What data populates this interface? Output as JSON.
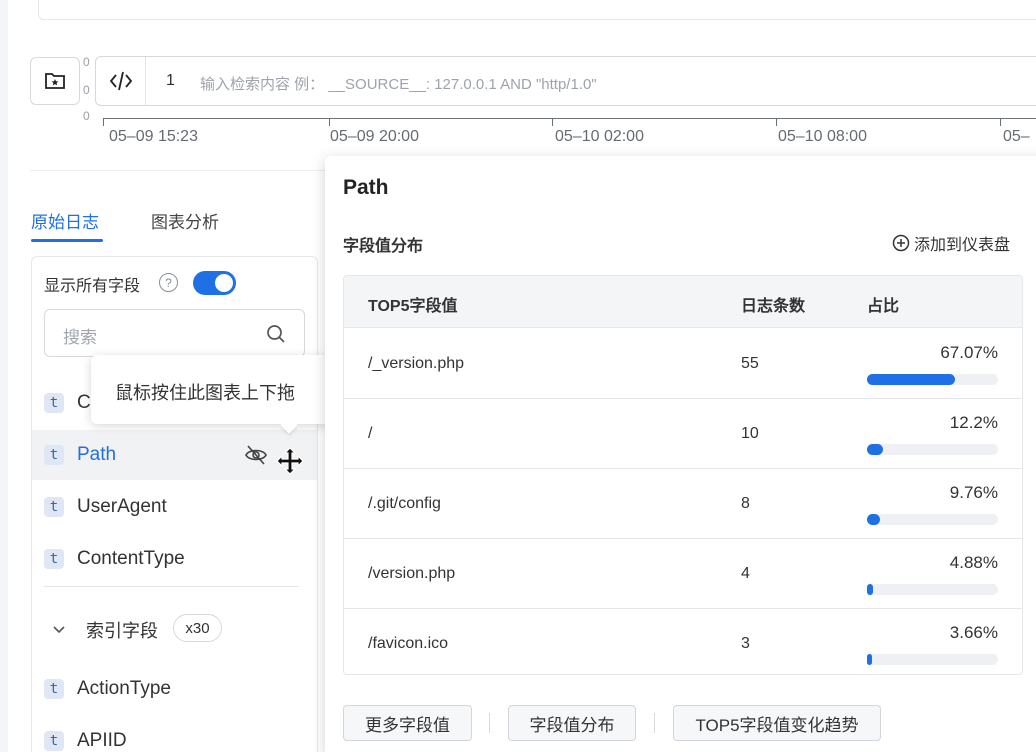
{
  "query_bar": {
    "line_number": "1",
    "placeholder": "输入检索内容 例： __SOURCE__: 127.0.0.1 AND \"http/1.0\"",
    "axis_zero_top": "0",
    "axis_zero_mid": "0",
    "axis_zero_bottom": "0"
  },
  "time_axis": {
    "labels": [
      "05–09 15:23",
      "05–09 20:00",
      "05–10 02:00",
      "05–10 08:00",
      "05–"
    ]
  },
  "tabs": [
    {
      "label": "原始日志",
      "active": true
    },
    {
      "label": "图表分析",
      "active": false
    }
  ],
  "field_panel": {
    "show_all_label": "显示所有字段",
    "help_icon": "?",
    "toggle_on": true,
    "search_placeholder": "搜索",
    "fields": [
      {
        "type": "t",
        "name": "C"
      },
      {
        "type": "t",
        "name": "Path"
      },
      {
        "type": "t",
        "name": "UserAgent"
      },
      {
        "type": "t",
        "name": "ContentType"
      }
    ],
    "index_group": {
      "label": "索引字段",
      "count": "x30"
    },
    "index_fields": [
      {
        "type": "t",
        "name": "ActionType"
      },
      {
        "type": "t",
        "name": "APIID"
      }
    ]
  },
  "tooltip": {
    "text": "鼠标按住此图表上下拖"
  },
  "popover": {
    "title": "Path",
    "subtitle": "字段值分布",
    "add_to_dashboard": "添加到仪表盘",
    "table": {
      "headers": [
        "TOP5字段值",
        "日志条数",
        "占比"
      ],
      "rows": [
        {
          "value": "/_version.php",
          "count": "55",
          "percent": "67.07%",
          "ratio": 0.6707
        },
        {
          "value": "/",
          "count": "10",
          "percent": "12.2%",
          "ratio": 0.122
        },
        {
          "value": "/.git/config",
          "count": "8",
          "percent": "9.76%",
          "ratio": 0.0976
        },
        {
          "value": "/version.php",
          "count": "4",
          "percent": "4.88%",
          "ratio": 0.0488
        },
        {
          "value": "/favicon.ico",
          "count": "3",
          "percent": "3.66%",
          "ratio": 0.0366
        }
      ]
    },
    "footer_buttons": [
      "更多字段值",
      "字段值分布",
      "TOP5字段值变化趋势"
    ]
  },
  "colors": {
    "accent": "#1f6fe5",
    "bar_track": "#eef0f3",
    "type_badge_bg": "#dfe7f5"
  }
}
